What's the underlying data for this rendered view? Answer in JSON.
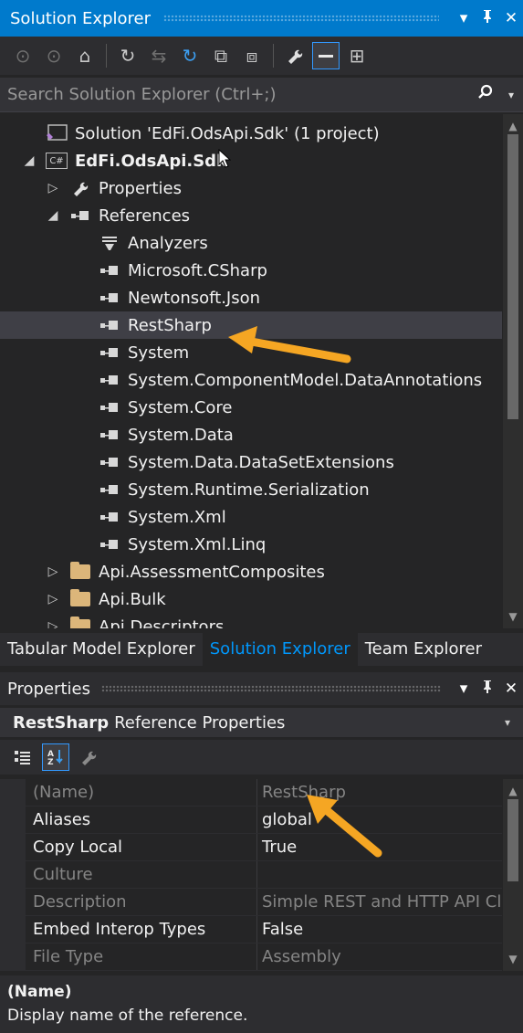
{
  "solution_explorer": {
    "title": "Solution Explorer",
    "title_buttons": {
      "dropdown": "▾",
      "pin": "ᵖ",
      "close": "✕"
    },
    "search_placeholder": "Search Solution Explorer (Ctrl+;)",
    "tree": [
      {
        "label": "Solution 'EdFi.OdsApi.Sdk' (1 project)",
        "icon": "solution-icon",
        "level": 0,
        "expander": ""
      },
      {
        "label": "EdFi.OdsApi.Sdk",
        "icon": "csharp-project-icon",
        "level": 0,
        "expander": "◢",
        "bold": true
      },
      {
        "label": "Properties",
        "icon": "wrench-icon",
        "level": 1,
        "expander": "▷"
      },
      {
        "label": "References",
        "icon": "reference-icon",
        "level": 1,
        "expander": "◢"
      },
      {
        "label": "Analyzers",
        "icon": "analyzer-icon",
        "level": 2,
        "expander": ""
      },
      {
        "label": "Microsoft.CSharp",
        "icon": "reference-icon",
        "level": 2,
        "expander": ""
      },
      {
        "label": "Newtonsoft.Json",
        "icon": "reference-icon",
        "level": 2,
        "expander": ""
      },
      {
        "label": "RestSharp",
        "icon": "reference-icon",
        "level": 2,
        "expander": "",
        "selected": true
      },
      {
        "label": "System",
        "icon": "reference-icon",
        "level": 2,
        "expander": ""
      },
      {
        "label": "System.ComponentModel.DataAnnotations",
        "icon": "reference-icon",
        "level": 2,
        "expander": ""
      },
      {
        "label": "System.Core",
        "icon": "reference-icon",
        "level": 2,
        "expander": ""
      },
      {
        "label": "System.Data",
        "icon": "reference-icon",
        "level": 2,
        "expander": ""
      },
      {
        "label": "System.Data.DataSetExtensions",
        "icon": "reference-icon",
        "level": 2,
        "expander": ""
      },
      {
        "label": "System.Runtime.Serialization",
        "icon": "reference-icon",
        "level": 2,
        "expander": ""
      },
      {
        "label": "System.Xml",
        "icon": "reference-icon",
        "level": 2,
        "expander": ""
      },
      {
        "label": "System.Xml.Linq",
        "icon": "reference-icon",
        "level": 2,
        "expander": ""
      },
      {
        "label": "Api.AssessmentComposites",
        "icon": "folder-icon",
        "level": 1,
        "expander": "▷"
      },
      {
        "label": "Api.Bulk",
        "icon": "folder-icon",
        "level": 1,
        "expander": "▷"
      },
      {
        "label": "Api.Descriptors",
        "icon": "folder-icon",
        "level": 1,
        "expander": "▷"
      }
    ],
    "tabs": [
      {
        "label": "Tabular Model Explorer",
        "active": false
      },
      {
        "label": "Solution Explorer",
        "active": true
      },
      {
        "label": "Team Explorer",
        "active": false
      }
    ]
  },
  "properties": {
    "title": "Properties",
    "title_buttons": {
      "dropdown": "▾",
      "pin": "ᵖ",
      "close": "✕"
    },
    "object_name": "RestSharp",
    "object_type": "Reference Properties",
    "rows": [
      {
        "name": "(Name)",
        "value": "RestSharp",
        "readonly": true
      },
      {
        "name": "Aliases",
        "value": "global",
        "readonly": false
      },
      {
        "name": "Copy Local",
        "value": "True",
        "readonly": false
      },
      {
        "name": "Culture",
        "value": "",
        "readonly": true
      },
      {
        "name": "Description",
        "value": "Simple REST and HTTP API Cli",
        "readonly": true
      },
      {
        "name": "Embed Interop Types",
        "value": "False",
        "readonly": false
      },
      {
        "name": "File Type",
        "value": "Assembly",
        "readonly": true
      }
    ],
    "description_title": "(Name)",
    "description_text": "Display name of the reference."
  },
  "colors": {
    "accent": "#007acc",
    "annotation_arrow": "#f5a623",
    "tab_active": "#0097fb"
  }
}
